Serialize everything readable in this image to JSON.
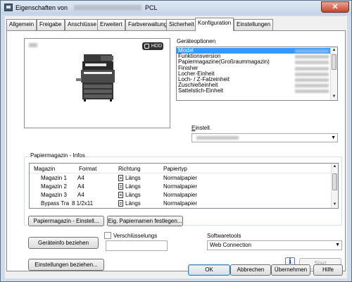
{
  "window": {
    "title_prefix": "Eigenschaften von",
    "title_suffix": "PCL",
    "close_icon": "close-icon",
    "title_icon": "printer-icon"
  },
  "tabs": [
    {
      "label": "Allgemein"
    },
    {
      "label": "Freigabe"
    },
    {
      "label": "Anschlüsse"
    },
    {
      "label": "Erweitert"
    },
    {
      "label": "Farbverwaltung"
    },
    {
      "label": "Sicherheit"
    },
    {
      "label": "Konfiguration",
      "active": true
    },
    {
      "label": "Einstellungen"
    }
  ],
  "preview": {
    "hdd_badge": "HDD",
    "device_icon": "multifunction-printer-icon"
  },
  "geraeteoptionen": {
    "label": "Geräteoptionen",
    "items": [
      {
        "label": "Model",
        "selected": true
      },
      {
        "label": "Funktionsversion"
      },
      {
        "label": "Papiermagazine(Großraummagazin)"
      },
      {
        "label": "Finisher"
      },
      {
        "label": "Locher-Einheit"
      },
      {
        "label": "Loch- / Z-Falzeinheit"
      },
      {
        "label": "Zuschießeinheit"
      },
      {
        "label": "Sattelstich-Einheit"
      }
    ]
  },
  "einstell": {
    "label": "Einstell.",
    "value": ""
  },
  "papiermagazin": {
    "label": "Papiermagazin - Infos",
    "columns": [
      "Magazin",
      "Format",
      "Richtung",
      "Papiertyp"
    ],
    "rows": [
      {
        "magazin": "Magazin 1",
        "format": "A4",
        "richtung": "Längs",
        "papiertyp": "Normalpapier"
      },
      {
        "magazin": "Magazin 2",
        "format": "A4",
        "richtung": "Längs",
        "papiertyp": "Normalpapier"
      },
      {
        "magazin": "Magazin 3",
        "format": "A4",
        "richtung": "Längs",
        "papiertyp": "Normalpapier"
      },
      {
        "magazin": "Bypass Tra",
        "format": "8 1/2x11",
        "richtung": "Längs",
        "papiertyp": "Normalpapier"
      }
    ],
    "btn_einstell": "Papiermagazin - Einstell...",
    "btn_papiernamen": "Eig. Papiernamen festlegen..."
  },
  "geraeteinfo_btn": "Geräteinfo beziehen",
  "verschluesselung": {
    "label": "Verschlüsselungs",
    "checked": false,
    "value": ""
  },
  "softwaretools": {
    "label": "Softwaretools",
    "value": "Web Connection"
  },
  "einstellungen_btn": "Einstellungen beziehen...",
  "info_icon": "info-icon",
  "start_btn": "Start",
  "footer": {
    "ok": "OK",
    "abbrechen": "Abbrechen",
    "uebernehmen": "Übernehmen",
    "hilfe": "Hilfe"
  }
}
